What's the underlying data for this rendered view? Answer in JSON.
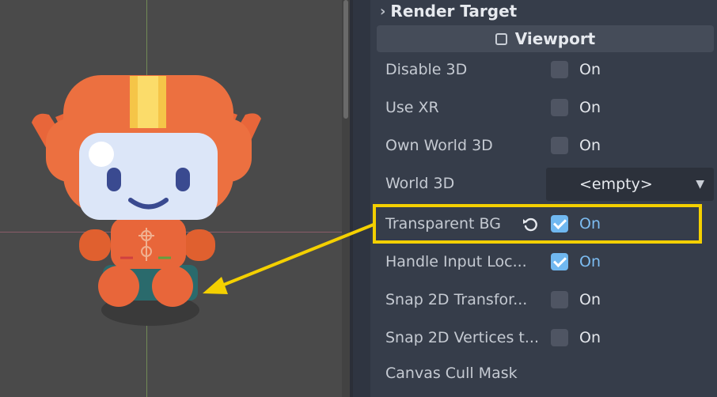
{
  "inspector": {
    "section_title": "Render Target",
    "subsection_title": "Viewport",
    "properties": [
      {
        "label": "Disable 3D",
        "type": "checkbox",
        "checked": false,
        "value_text": "On"
      },
      {
        "label": "Use XR",
        "type": "checkbox",
        "checked": false,
        "value_text": "On"
      },
      {
        "label": "Own World 3D",
        "type": "checkbox",
        "checked": false,
        "value_text": "On"
      },
      {
        "label": "World 3D",
        "type": "resource",
        "value_text": "<empty>"
      },
      {
        "label": "Transparent BG",
        "type": "checkbox",
        "checked": true,
        "value_text": "On",
        "revertable": true,
        "highlighted": true
      },
      {
        "label": "Handle Input Loc...",
        "type": "checkbox",
        "checked": true,
        "value_text": "On"
      },
      {
        "label": "Snap 2D Transfor...",
        "type": "checkbox",
        "checked": false,
        "value_text": "On"
      },
      {
        "label": "Snap 2D Vertices t...",
        "type": "checkbox",
        "checked": false,
        "value_text": "On"
      },
      {
        "label": "Canvas Cull Mask",
        "type": "layers"
      }
    ]
  },
  "viewport": {
    "sprite": "godot-robot-icon"
  },
  "icons": {
    "section_chevron": "chevron-right-icon",
    "revert": "revert-icon",
    "dropdown": "chevron-down-icon"
  },
  "colors": {
    "highlight": "#f4d000",
    "accent": "#70b8f0",
    "viewport_bg": "#4a4a4a",
    "inspector_bg": "#363d4a"
  }
}
